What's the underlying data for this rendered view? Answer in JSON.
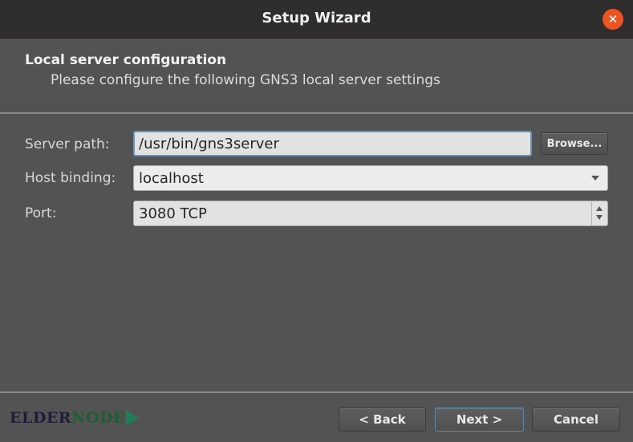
{
  "window": {
    "title": "Setup Wizard",
    "close_icon": "close-icon",
    "close_color": "#e95420"
  },
  "header": {
    "title": "Local server configuration",
    "subtitle": "Please configure the following GNS3 local server settings"
  },
  "form": {
    "server_path": {
      "label": "Server path:",
      "value": "/usr/bin/gns3server",
      "browse_label": "Browse..."
    },
    "host_binding": {
      "label": "Host binding:",
      "value": "localhost"
    },
    "port": {
      "label": "Port:",
      "value": "3080 TCP"
    }
  },
  "footer": {
    "logo_part1": "ELDER",
    "logo_part2": "NODE",
    "back_label": "< Back",
    "next_label": "Next >",
    "cancel_label": "Cancel"
  }
}
